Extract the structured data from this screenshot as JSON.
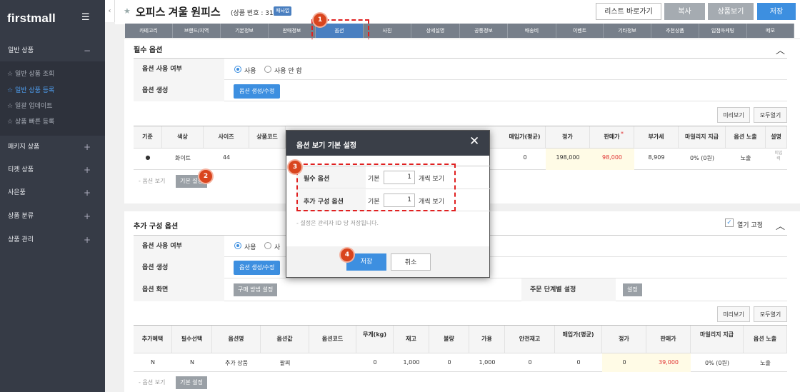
{
  "sidebar": {
    "logo": "firstmall",
    "sections": [
      {
        "label": "일반 상품",
        "toggle": "−"
      },
      {
        "label": "패키지 상품",
        "toggle": "+"
      },
      {
        "label": "티켓 상품",
        "toggle": "+"
      },
      {
        "label": "사은품",
        "toggle": "+"
      },
      {
        "label": "상품 분류",
        "toggle": "+"
      },
      {
        "label": "상품 관리",
        "toggle": "+"
      }
    ],
    "subitems": [
      {
        "label": "일반 상품 조회"
      },
      {
        "label": "일반 상품 등록"
      },
      {
        "label": "일괄 업데이트"
      },
      {
        "label": "상품 빠른 등록"
      }
    ]
  },
  "header": {
    "title": "오피스 겨울 원피스",
    "product_no": "(상품 번호 : 31)",
    "badge": "패놔없",
    "buttons": {
      "list": "리스트 바로가기",
      "copy": "복사",
      "view": "상품보기",
      "save": "저장"
    }
  },
  "tabs": [
    "카테고리",
    "브랜드/지역",
    "기본정보",
    "판매정보",
    "옵션",
    "사진",
    "상세설명",
    "공통정보",
    "배송비",
    "이벤트",
    "기타정보",
    "추천상품",
    "입점마케팅",
    "메모"
  ],
  "required_options": {
    "title": "필수 옵션",
    "use_label": "옵션 사용 여부",
    "use_on": "사용",
    "use_off": "사용 안 함",
    "create_label": "옵션 생성",
    "create_btn": "옵션 생성/수정",
    "preview_btn": "미리보기",
    "expand_btn": "모두열기",
    "table": {
      "headers": [
        "기준",
        "색상",
        "사이즈",
        "상품코드",
        "매입가(평균)",
        "정가",
        "판매가",
        "부가세",
        "마일리지 지급",
        "옵션 노출",
        "설명"
      ],
      "row": {
        "base": "●",
        "color": "화이트",
        "size": "44",
        "purchase": "0",
        "list_price": "198,000",
        "sale_price": "98,000",
        "vat": "8,909",
        "mileage": "0% (0원)",
        "expose": "노출",
        "desc": "미입력"
      },
      "sale_price_mark": "*"
    },
    "view_label": "옵션 보기",
    "default_btn": "기본 설정"
  },
  "additional_options": {
    "title": "추가 구성 옵션",
    "fix_label": "열기 고정",
    "use_label": "옵션 사용 여부",
    "use_on": "사용",
    "use_off_partial": "사",
    "create_label": "옵션 생성",
    "create_btn": "옵션 생성/수정",
    "screen_label": "옵션 화면",
    "purchase_method_btn": "구매 방법 설정",
    "order_step_label": "주문 단계별 설정",
    "order_step_btn": "설정",
    "preview_btn": "미리보기",
    "expand_btn": "모두열기",
    "table": {
      "headers": [
        "추가혜택",
        "필수선택",
        "옵션명",
        "옵션값",
        "옵션코드",
        "무게(kg)",
        "재고",
        "불량",
        "가용",
        "안전재고",
        "매입가(평균)",
        "정가",
        "판매가",
        "마일리지 지급",
        "옵션 노출"
      ],
      "row": [
        "N",
        "N",
        "추가 상품",
        "팔찌",
        "",
        "0",
        "1,000",
        "0",
        "1,000",
        "0",
        "0",
        "0",
        "39,000",
        "0% (0원)",
        "노출"
      ]
    },
    "view_label": "옵션 보기",
    "default_btn": "기본 설정"
  },
  "dialog": {
    "title": "옵션 보기 기본 설정",
    "rows": [
      {
        "label": "필수 옵션",
        "prefix": "기본",
        "value": "1",
        "suffix": "개씩 보기"
      },
      {
        "label": "추가 구성 옵션",
        "prefix": "기본",
        "value": "1",
        "suffix": "개씩 보기"
      }
    ],
    "note": "설정은 관리자 ID 당 저장됩니다.",
    "save_btn": "저장",
    "cancel_btn": "취소"
  },
  "callouts": [
    "1",
    "2",
    "3",
    "4"
  ],
  "colors": {
    "accent": "#3d8fe0",
    "sidebar": "#363b46",
    "callout": "#d9451e",
    "tab_active": "#4a7fc0"
  }
}
